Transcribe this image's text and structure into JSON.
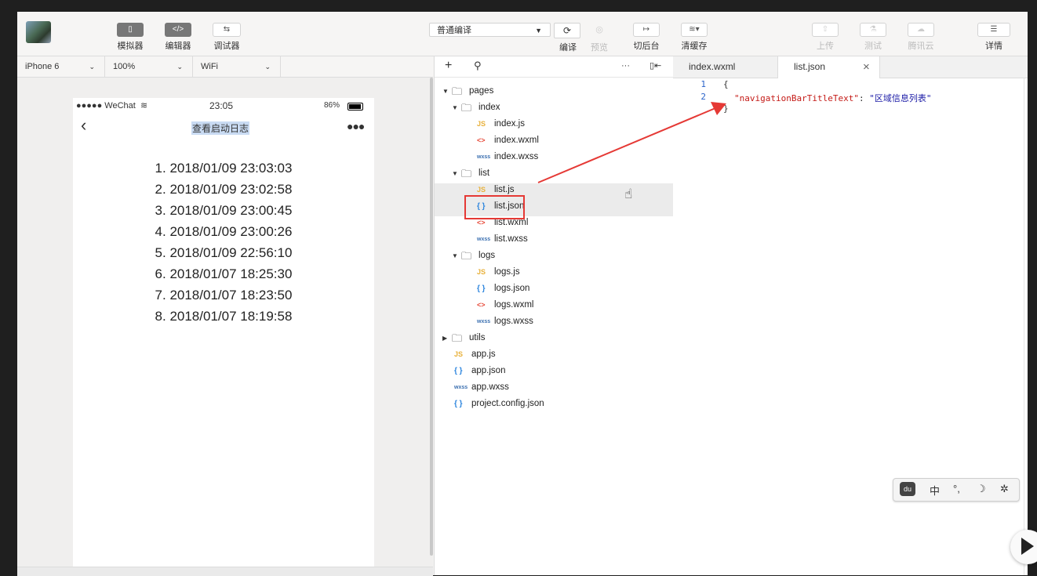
{
  "toolbar": {
    "left_buttons": [
      {
        "label": "模拟器",
        "icon": "phone-icon",
        "glyph": "▯"
      },
      {
        "label": "编辑器",
        "icon": "code-icon",
        "glyph": "</>"
      },
      {
        "label": "调试器",
        "icon": "debug-icon",
        "glyph": "⇆"
      }
    ],
    "compile_mode": "普通编译",
    "compile_label": "编译",
    "preview_label": "预览",
    "background_label": "切后台",
    "cache_label": "清缓存",
    "upload_label": "上传",
    "test_label": "测试",
    "cloud_label": "腾讯云",
    "details_label": "详情"
  },
  "subbar": {
    "device": "iPhone 6",
    "zoom": "100%",
    "network": "WiFi"
  },
  "simulator": {
    "carrier": "●●●●● WeChat",
    "time": "23:05",
    "battery": "86%",
    "page_title": "查看启动日志",
    "logs": [
      "1. 2018/01/09 23:03:03",
      "2. 2018/01/09 23:02:58",
      "3. 2018/01/09 23:00:45",
      "4. 2018/01/09 23:00:26",
      "5. 2018/01/09 22:56:10",
      "6. 2018/01/07 18:25:30",
      "7. 2018/01/07 18:23:50",
      "8. 2018/01/07 18:19:58"
    ]
  },
  "tree": {
    "add": "+",
    "more": "···",
    "items": [
      {
        "label": "pages",
        "type": "folder",
        "open": true,
        "level": 0
      },
      {
        "label": "index",
        "type": "folder",
        "open": true,
        "level": 1
      },
      {
        "label": "index.js",
        "type": "js",
        "level": 2
      },
      {
        "label": "index.wxml",
        "type": "wxml",
        "level": 2
      },
      {
        "label": "index.wxss",
        "type": "wxss",
        "level": 2
      },
      {
        "label": "list",
        "type": "folder",
        "open": true,
        "level": 1
      },
      {
        "label": "list.js",
        "type": "js",
        "level": 2
      },
      {
        "label": "list.json",
        "type": "json",
        "level": 2
      },
      {
        "label": "list.wxml",
        "type": "wxml",
        "level": 2
      },
      {
        "label": "list.wxss",
        "type": "wxss",
        "level": 2
      },
      {
        "label": "logs",
        "type": "folder",
        "open": true,
        "level": 1
      },
      {
        "label": "logs.js",
        "type": "js",
        "level": 2
      },
      {
        "label": "logs.json",
        "type": "json",
        "level": 2
      },
      {
        "label": "logs.wxml",
        "type": "wxml",
        "level": 2
      },
      {
        "label": "logs.wxss",
        "type": "wxss",
        "level": 2
      },
      {
        "label": "utils",
        "type": "folder",
        "open": false,
        "level": 0
      },
      {
        "label": "app.js",
        "type": "js",
        "level": 0
      },
      {
        "label": "app.json",
        "type": "json",
        "level": 0
      },
      {
        "label": "app.wxss",
        "type": "wxss",
        "level": 0
      },
      {
        "label": "project.config.json",
        "type": "json",
        "level": 0
      }
    ]
  },
  "editor": {
    "tabs": [
      {
        "label": "index.wxml",
        "active": false
      },
      {
        "label": "list.json",
        "active": true
      }
    ],
    "close_glyph": "×",
    "line_numbers": [
      "1",
      "2"
    ],
    "code": {
      "open": "{",
      "key": "\"navigationBarTitleText\"",
      "colon": ": ",
      "value": "\"区域信息列表\"",
      "close": "}"
    }
  },
  "ime": {
    "mode": "中",
    "punct": "°,",
    "moon": "☽",
    "gear": "✲"
  },
  "colors": {
    "highlight_red": "#e53935",
    "key_red": "#c41a16",
    "value_blue": "#1a1aa6"
  }
}
